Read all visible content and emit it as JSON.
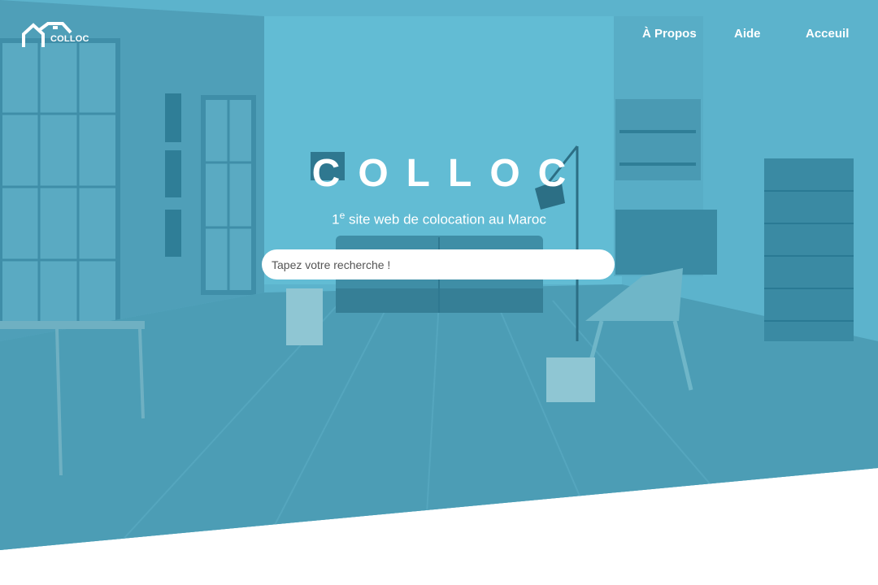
{
  "nav": {
    "logo_text": "COLLOC",
    "links": [
      {
        "label": "À Propos"
      },
      {
        "label": "Aide"
      },
      {
        "label": "Acceuil"
      }
    ]
  },
  "hero": {
    "title": "COLLOC",
    "subtitle_sup_num": "1",
    "subtitle_sup": "e",
    "subtitle_rest": " site web de colocation au Maroc",
    "search_placeholder": "Tapez votre recherche !"
  },
  "colors": {
    "overlay": "#5eb6cf",
    "text": "#ffffff"
  }
}
